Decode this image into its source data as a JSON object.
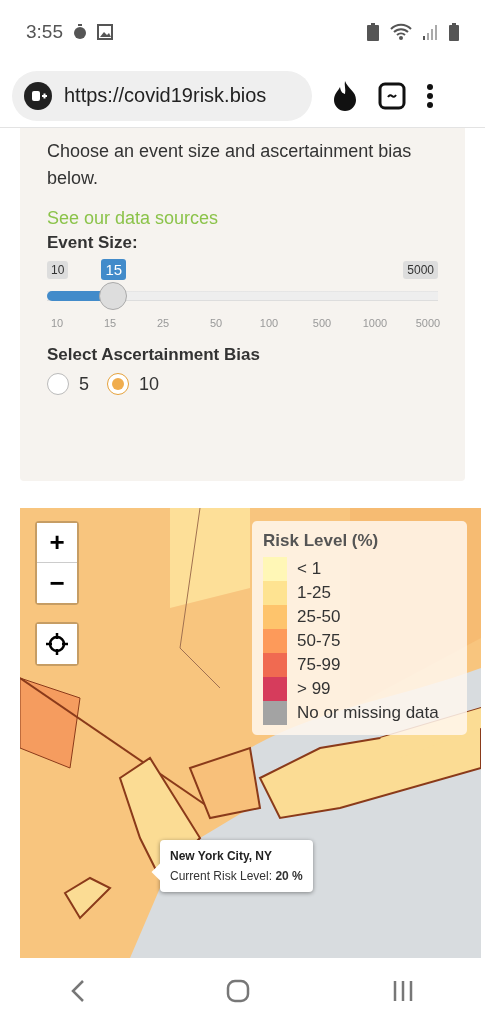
{
  "status_bar": {
    "time": "3:55"
  },
  "browser": {
    "url": "https://covid19risk.bios"
  },
  "panel": {
    "intro": "Choose an event size and ascertainment bias below.",
    "link": "See our data sources",
    "slider_label": "Event Size:",
    "slider": {
      "min_label": "10",
      "max_label": "5000",
      "value_label": "15",
      "level": 0.17,
      "ticks": [
        "10",
        "15",
        "25",
        "50",
        "100",
        "500",
        "1000",
        "5000"
      ]
    },
    "bias_label": "Select Ascertainment Bias",
    "bias_options": [
      {
        "label": "5",
        "selected": false
      },
      {
        "label": "10",
        "selected": true
      }
    ]
  },
  "map": {
    "zoom_in": "+",
    "zoom_out": "−",
    "legend": {
      "title": "Risk Level (%)",
      "items": [
        {
          "label": "< 1",
          "color": "#fff7b6"
        },
        {
          "label": "1-25",
          "color": "#fee391"
        },
        {
          "label": "25-50",
          "color": "#fec46c"
        },
        {
          "label": "50-75",
          "color": "#fd9a5a"
        },
        {
          "label": "75-99",
          "color": "#f06a51"
        },
        {
          "label": "> 99",
          "color": "#d63c5c"
        },
        {
          "label": "No or missing data",
          "color": "#a3a3a3"
        }
      ]
    },
    "tooltip": {
      "title": "New York City, NY",
      "text": "Current Risk Level: **20 %**"
    }
  }
}
